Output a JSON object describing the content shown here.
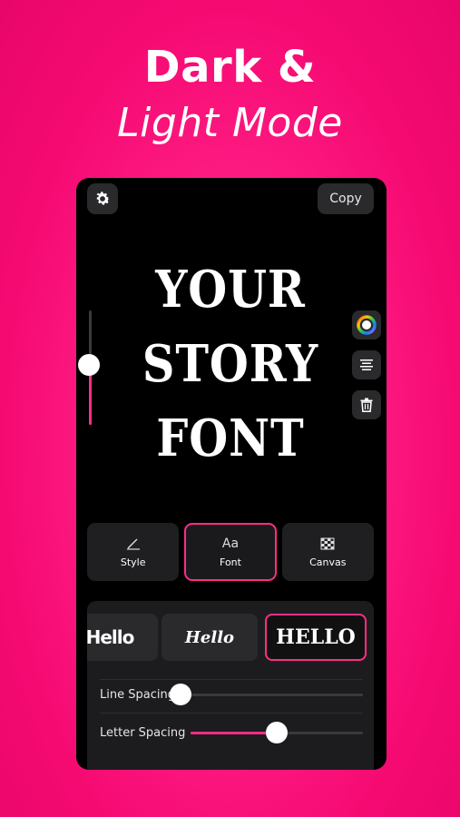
{
  "headline": {
    "line1": "Dark &",
    "line2": "Light Mode"
  },
  "top_bar": {
    "settings_icon": "gear-icon",
    "copy_label": "Copy"
  },
  "canvas": {
    "lines": [
      "YOUR",
      "STORY",
      "FONT"
    ],
    "size_level": 0.52
  },
  "side_tools": [
    "color-wheel-icon",
    "align-icon",
    "trash-icon"
  ],
  "tabs": [
    {
      "label": "Style",
      "icon": "pencil-icon",
      "active": false
    },
    {
      "label": "Font",
      "icon": "aa-icon",
      "icon_text": "Aa",
      "active": true
    },
    {
      "label": "Canvas",
      "icon": "checker-icon",
      "active": false
    }
  ],
  "fonts": [
    {
      "sample": "Hello",
      "active": false
    },
    {
      "sample": "Hello",
      "active": false
    },
    {
      "sample": "HELLO",
      "active": true
    }
  ],
  "sliders": {
    "line_spacing": {
      "label": "Line Spacing",
      "value": 0.0
    },
    "letter_spacing": {
      "label": "Letter Spacing",
      "value": 0.5
    }
  },
  "colors": {
    "accent": "#ff2d86",
    "background": "#f7127a",
    "phone": "#000000"
  }
}
